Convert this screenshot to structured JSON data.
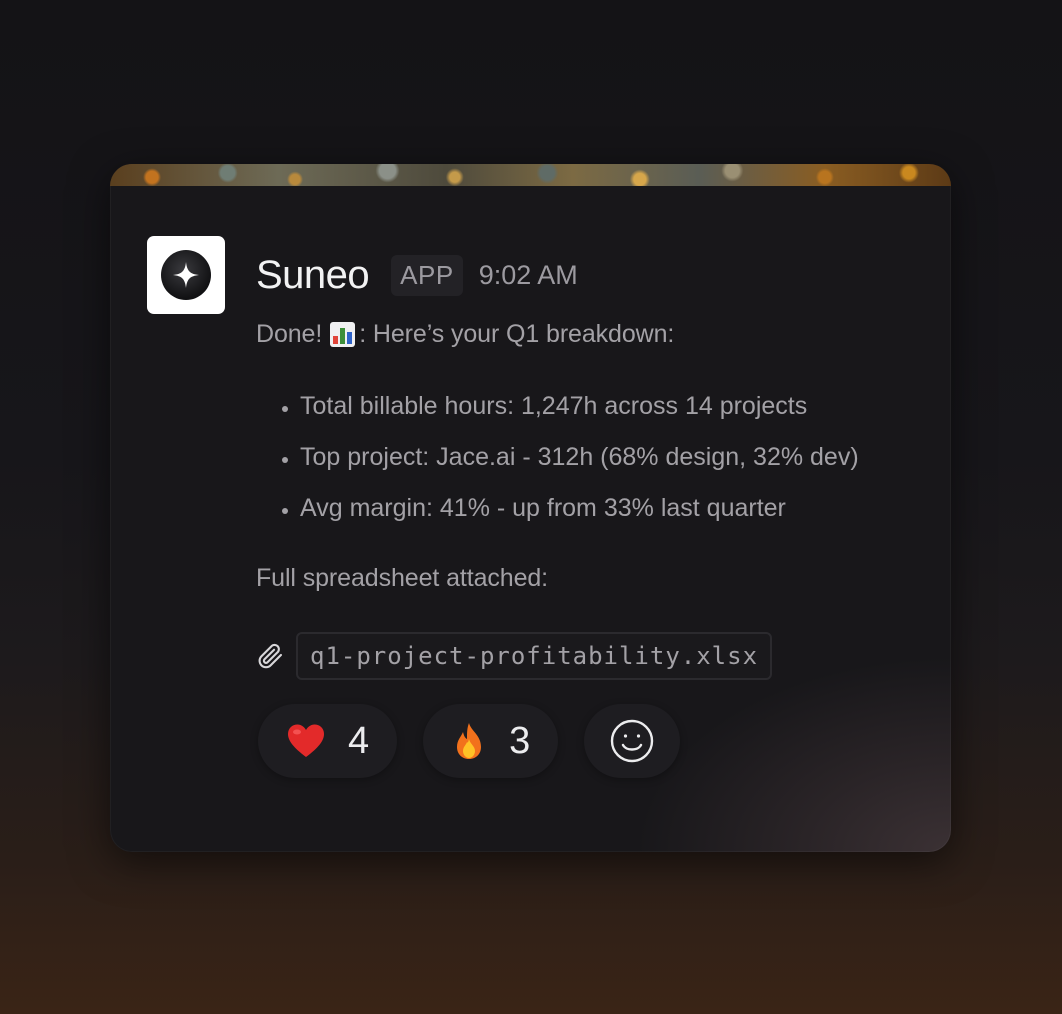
{
  "message": {
    "app_name": "Suneo",
    "badge": "APP",
    "time": "9:02 AM",
    "intro_before": "Done! ",
    "intro_after": ": Here’s your Q1 breakdown:",
    "bullets": [
      "Total billable hours: 1,247h across 14 projects",
      "Top project: Jace.ai - 312h (68% design, 32% dev)",
      "Avg margin: 41% - up from 33% last quarter"
    ],
    "spreadsheet_text": "Full spreadsheet attached:",
    "attachment": "q1-project-profitability.xlsx"
  },
  "reactions": [
    {
      "icon": "heart-emoji",
      "count": "4"
    },
    {
      "icon": "fire-emoji",
      "count": "3"
    }
  ],
  "colors": {
    "background": "#141316",
    "card": "#18171a",
    "text_primary": "#f2f2f3",
    "text_secondary": "#a3a1a6"
  }
}
